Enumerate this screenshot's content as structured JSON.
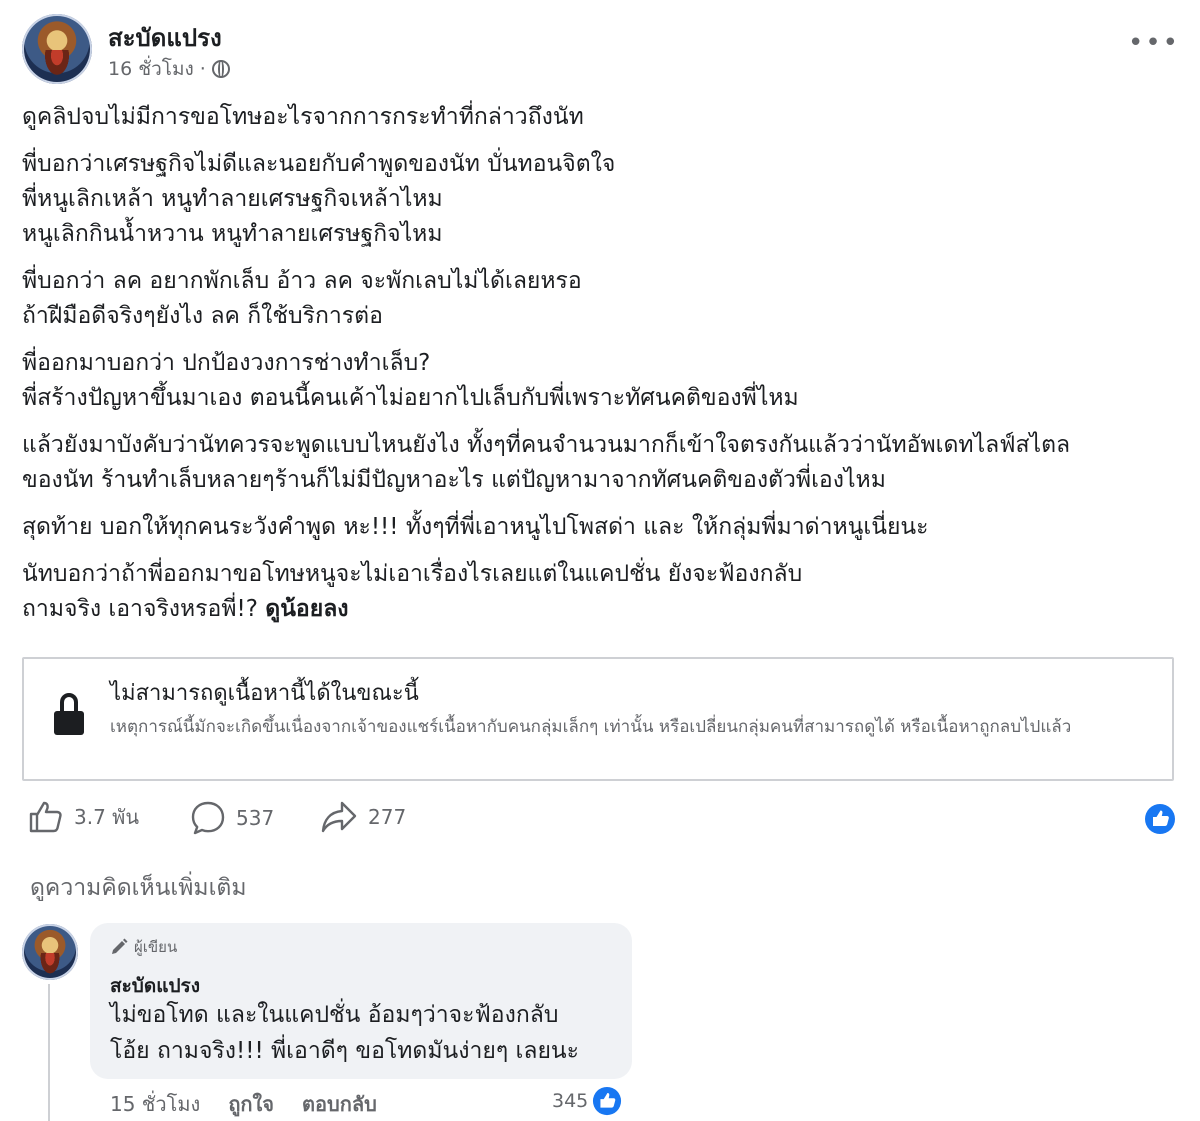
{
  "post": {
    "author": "สะบัดแปรง",
    "time": "16 ชั่วโมง",
    "privacy_icon": "globe-icon",
    "more_label": "•••",
    "paragraphs": [
      [
        "ดูคลิปจบไม่มีการขอโทษอะไรจากการกระทำที่กล่าวถึงนัท"
      ],
      [
        "พี่บอกว่าเศรษฐกิจไม่ดีและนอยกับคำพูดของนัท บั่นทอนจิตใจ",
        "พี่หนูเลิกเหล้า หนูทำลายเศรษฐกิจเหล้าไหม",
        "หนูเลิกกินน้ำหวาน  หนูทำลายเศรษฐกิจไหม"
      ],
      [
        "พี่บอกว่า ลค อยากพักเล็บ อ้าว ลค จะพักเลบไม่ได้เลยหรอ",
        "ถ้าฝีมือดีจริงๆยังไง ลค ก็ใช้บริการต่อ"
      ],
      [
        "พี่ออกมาบอกว่า ปกป้องวงการช่างทำเล็บ?",
        "พี่สร้างปัญหาขึ้นมาเอง ตอนนี้คนเค้าไม่อยากไปเล็บกับพี่เพราะทัศนคติของพี่ไหม"
      ],
      [
        "แล้วยังมาบังคับว่านัทควรจะพูดแบบไหนยังไง ทั้งๆที่คนจำนวนมากก็เข้าใจตรงกันแล้วว่านัทอัพเดทไลฟ์สไตล",
        "ของนัท ร้านทำเล็บหลายๆร้านก็ไม่มีปัญหาอะไร แต่ปัญหามาจากทัศนคติของตัวพี่เองไหม"
      ],
      [
        "สุดท้าย บอกให้ทุกคนระวังคำพูด หะ!!! ทั้งๆที่พี่เอาหนูไปโพสด่า และ ให้กลุ่มพี่มาด่าหนูเนี่ยนะ"
      ],
      [
        "นัทบอกว่าถ้าพี่ออกมาขอโทษหนูจะไม่เอาเรื่องไรเลยแต่ในแคปชั่น ยังจะฟ้องกลับ"
      ]
    ],
    "last_line_prefix": "ถามจริง เอาจริงหรอพี่!? ",
    "last_line_bold": "ดูน้อยลง"
  },
  "unavailable": {
    "title": "ไม่สามารถดูเนื้อหานี้ได้ในขณะนี้",
    "description": "เหตุการณ์นี้มักจะเกิดขึ้นเนื่องจากเจ้าของแชร์เนื้อหากับคนกลุ่มเล็กๆ เท่านั้น หรือเปลี่ยนกลุ่มคนที่สามารถดูได้ หรือเนื้อหาถูกลบไปแล้ว",
    "icon": "lock-icon"
  },
  "stats": {
    "likes": "3.7 พัน",
    "comments": "537",
    "shares": "277"
  },
  "view_more_comments": "ดูความคิดเห็นเพิ่มเติม",
  "comment": {
    "badge": "ผู้เขียน",
    "author": "สะบัดแปรง",
    "lines": [
      "ไม่ขอโทด และในแคปชั่น อ้อมๆว่าจะฟ้องกลับ",
      "โอ้ย ถามจริง!!! พี่เอาดีๆ ขอโทดมันง่ายๆ เลยนะ"
    ],
    "time": "15 ชั่วโมง",
    "like_label": "ถูกใจ",
    "reply_label": "ตอบกลับ",
    "reaction_count": "345"
  },
  "colors": {
    "accent": "#1877f2",
    "secondary_text": "#65676b",
    "bubble": "#f0f2f5",
    "border": "#ced0d4"
  }
}
